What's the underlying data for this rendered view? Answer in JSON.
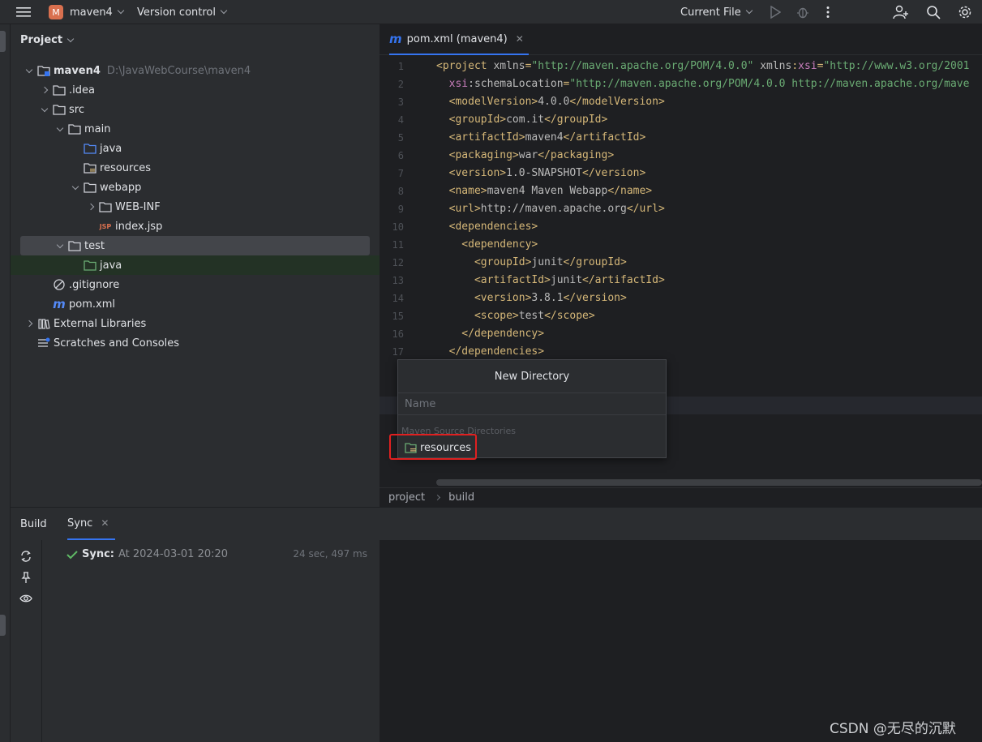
{
  "toolbar": {
    "project_badge": "M",
    "project_name": "maven4",
    "vcs": "Version control",
    "run_config": "Current File"
  },
  "project_panel": {
    "title": "Project",
    "tree": [
      {
        "label": "maven4",
        "hint": "D:\\JavaWebCourse\\maven4",
        "depth": 0,
        "toggle": "open",
        "icon": "module-folder"
      },
      {
        "label": ".idea",
        "depth": 1,
        "toggle": "closed",
        "icon": "folder"
      },
      {
        "label": "src",
        "depth": 1,
        "toggle": "open",
        "icon": "folder"
      },
      {
        "label": "main",
        "depth": 2,
        "toggle": "open",
        "icon": "folder"
      },
      {
        "label": "java",
        "depth": 3,
        "toggle": "none",
        "icon": "source-folder"
      },
      {
        "label": "resources",
        "depth": 3,
        "toggle": "none",
        "icon": "resources-folder"
      },
      {
        "label": "webapp",
        "depth": 3,
        "toggle": "open",
        "icon": "folder"
      },
      {
        "label": "WEB-INF",
        "depth": 4,
        "toggle": "closed",
        "icon": "folder"
      },
      {
        "label": "index.jsp",
        "depth": 4,
        "toggle": "none",
        "icon": "jsp-file"
      },
      {
        "label": "test",
        "depth": 2,
        "toggle": "open",
        "icon": "folder",
        "selected": true
      },
      {
        "label": "java",
        "depth": 3,
        "toggle": "none",
        "icon": "test-source-folder",
        "highlight": true
      },
      {
        "label": ".gitignore",
        "depth": 1,
        "toggle": "none",
        "icon": "ignore-file"
      },
      {
        "label": "pom.xml",
        "depth": 1,
        "toggle": "none",
        "icon": "maven-file"
      },
      {
        "label": "External Libraries",
        "depth": 0,
        "toggle": "closed",
        "icon": "library"
      },
      {
        "label": "Scratches and Consoles",
        "depth": 0,
        "toggle": "none",
        "icon": "scratches"
      }
    ]
  },
  "editor": {
    "tab_label": "pom.xml (maven4)",
    "line_numbers": [
      "1",
      "2",
      "3",
      "4",
      "5",
      "6",
      "7",
      "8",
      "9",
      "10",
      "11",
      "12",
      "13",
      "14",
      "15",
      "16",
      "17",
      "1",
      "1",
      "2",
      "2",
      "2"
    ],
    "code_lines": [
      [
        [
          "t",
          "<project "
        ],
        [
          "a",
          "xmlns"
        ],
        [
          "t",
          "="
        ],
        [
          "v",
          "\"http://maven.apache.org/POM/4.0.0\""
        ],
        [
          "t",
          " "
        ],
        [
          "a",
          "xmlns"
        ],
        [
          "t",
          ":"
        ],
        [
          "ns",
          "xsi"
        ],
        [
          "t",
          "="
        ],
        [
          "v",
          "\"http://www.w3.org/2001"
        ]
      ],
      [
        [
          "t",
          "  "
        ],
        [
          "ns",
          "xsi"
        ],
        [
          "a",
          ":schemaLocation"
        ],
        [
          "t",
          "="
        ],
        [
          "v",
          "\"http://maven.apache.org/POM/4.0.0 http://maven.apache.org/mave"
        ]
      ],
      [
        [
          "t",
          "  <modelVersion>"
        ],
        [
          "a",
          "4.0.0"
        ],
        [
          "t",
          "</modelVersion>"
        ]
      ],
      [
        [
          "t",
          "  <groupId>"
        ],
        [
          "a",
          "com.it"
        ],
        [
          "t",
          "</groupId>"
        ]
      ],
      [
        [
          "t",
          "  <artifactId>"
        ],
        [
          "a",
          "maven4"
        ],
        [
          "t",
          "</artifactId>"
        ]
      ],
      [
        [
          "t",
          "  <packaging>"
        ],
        [
          "a",
          "war"
        ],
        [
          "t",
          "</packaging>"
        ]
      ],
      [
        [
          "t",
          "  <version>"
        ],
        [
          "a",
          "1.0-SNAPSHOT"
        ],
        [
          "t",
          "</version>"
        ]
      ],
      [
        [
          "t",
          "  <name>"
        ],
        [
          "a",
          "maven4 Maven Webapp"
        ],
        [
          "t",
          "</name>"
        ]
      ],
      [
        [
          "t",
          "  <url>"
        ],
        [
          "a",
          "http://maven.apache.org"
        ],
        [
          "t",
          "</url>"
        ]
      ],
      [
        [
          "t",
          "  <dependencies>"
        ]
      ],
      [
        [
          "t",
          "    <dependency>"
        ]
      ],
      [
        [
          "t",
          "      <groupId>"
        ],
        [
          "a",
          "junit"
        ],
        [
          "t",
          "</groupId>"
        ]
      ],
      [
        [
          "t",
          "      <artifactId>"
        ],
        [
          "a",
          "junit"
        ],
        [
          "t",
          "</artifactId>"
        ]
      ],
      [
        [
          "t",
          "      <version>"
        ],
        [
          "a",
          "3.8.1"
        ],
        [
          "t",
          "</version>"
        ]
      ],
      [
        [
          "t",
          "      <scope>"
        ],
        [
          "a",
          "test"
        ],
        [
          "t",
          "</scope>"
        ]
      ],
      [
        [
          "t",
          "    </dependency>"
        ]
      ],
      [
        [
          "t",
          "  </dependencies>"
        ]
      ]
    ],
    "breadcrumbs": [
      "project",
      "build"
    ]
  },
  "popup": {
    "title": "New Directory",
    "input_placeholder": "Name",
    "section": "Maven Source Directories",
    "item": "resources"
  },
  "build_panel": {
    "tabs": [
      "Build",
      "Sync"
    ],
    "sync_label": "Sync:",
    "sync_text": "At 2024-03-01 20:20",
    "sync_duration": "24 sec, 497 ms"
  },
  "watermark": "CSDN @无尽的沉默",
  "colors": {
    "accent": "#3574f0",
    "highlight_box": "#e02020",
    "success": "#5fb865"
  }
}
